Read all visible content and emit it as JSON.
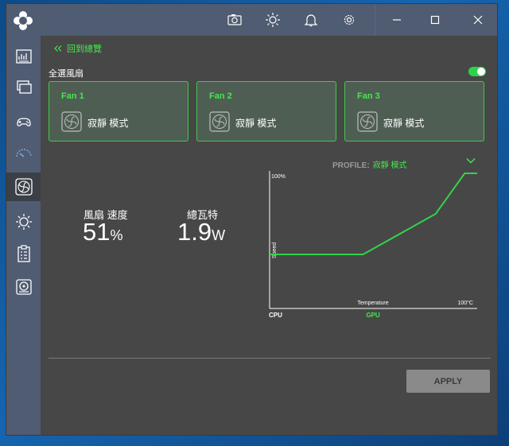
{
  "titlebar": {
    "icons": [
      "camera-icon",
      "brightness-icon",
      "bell-icon",
      "gear-icon",
      "minimize-icon",
      "maximize-icon",
      "close-icon"
    ]
  },
  "sidebar": {
    "items": [
      {
        "icon": "dashboard-icon"
      },
      {
        "icon": "monitor-icon"
      },
      {
        "icon": "gamepad-icon"
      },
      {
        "icon": "speedometer-icon"
      },
      {
        "icon": "fan-icon",
        "active": true
      },
      {
        "icon": "sun-icon"
      },
      {
        "icon": "clipboard-icon"
      },
      {
        "icon": "drive-icon"
      }
    ]
  },
  "main": {
    "back_label": "回到總覽",
    "select_all_label": "全選風扇",
    "select_all_enabled": true,
    "fans": [
      {
        "name": "Fan 1",
        "mode": "寂靜 模式"
      },
      {
        "name": "Fan 2",
        "mode": "寂靜 模式"
      },
      {
        "name": "Fan 3",
        "mode": "寂靜 模式"
      }
    ],
    "profile_label": "PROFILE:",
    "profile_value": "寂靜 模式",
    "fan_speed_label": "風扇 速度",
    "fan_speed_value": "51",
    "fan_speed_unit": "%",
    "power_label": "總瓦特",
    "power_value": "1.9",
    "power_unit": "W",
    "apply_label": "APPLY"
  },
  "chart_data": {
    "type": "line",
    "series": [
      {
        "x": [
          0,
          45,
          80,
          94,
          100
        ],
        "values": [
          40,
          40,
          70,
          100,
          100
        ]
      }
    ],
    "xlabel": "Temperature",
    "ylabel": "Speed",
    "ymax_label": "100%",
    "xmax_label": "100°C",
    "source_cpu": "CPU",
    "source_gpu": "GPU",
    "xlim": [
      0,
      100
    ],
    "ylim": [
      0,
      100
    ],
    "line_color": "#33d34a"
  }
}
